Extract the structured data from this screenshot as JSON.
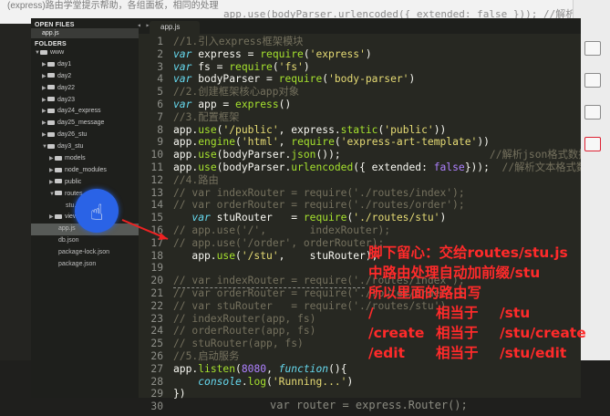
{
  "background": {
    "top_ghost_title": "(express)路由学堂提示帮助，各组面板，相同的处理",
    "top_ghost_code": "app.use(bodyParser.urlencoded({ extended: false })); //解析文本格式",
    "bottom_ghost_code": "var router = express.Router();"
  },
  "sidebar": {
    "open_files_header": "OPEN FILES",
    "open_file": "app.js",
    "folders_header": "FOLDERS",
    "tree": [
      {
        "label": "www",
        "level": 0,
        "type": "folder",
        "open": true
      },
      {
        "label": "day1",
        "level": 1,
        "type": "folder"
      },
      {
        "label": "day2",
        "level": 1,
        "type": "folder"
      },
      {
        "label": "day22",
        "level": 1,
        "type": "folder"
      },
      {
        "label": "day23",
        "level": 1,
        "type": "folder"
      },
      {
        "label": "day24_express",
        "level": 1,
        "type": "folder"
      },
      {
        "label": "day25_message",
        "level": 1,
        "type": "folder"
      },
      {
        "label": "day26_stu",
        "level": 1,
        "type": "folder"
      },
      {
        "label": "day3_stu",
        "level": 1,
        "type": "folder",
        "open": true
      },
      {
        "label": "models",
        "level": 2,
        "type": "folder"
      },
      {
        "label": "node_modules",
        "level": 2,
        "type": "folder"
      },
      {
        "label": "public",
        "level": 2,
        "type": "folder"
      },
      {
        "label": "routes",
        "level": 2,
        "type": "folder",
        "open": true
      },
      {
        "label": "stu.js",
        "level": 3,
        "type": "file"
      },
      {
        "label": "views",
        "level": 2,
        "type": "folder"
      },
      {
        "label": "app.js",
        "level": 2,
        "type": "file",
        "selected": true
      },
      {
        "label": "db.json",
        "level": 2,
        "type": "file"
      },
      {
        "label": "package-lock.json",
        "level": 2,
        "type": "file"
      },
      {
        "label": "package.json",
        "level": 2,
        "type": "file"
      }
    ]
  },
  "editor": {
    "tab_label": "app.js",
    "tab_nav": "◂ ▸",
    "line_numbers": [
      "1",
      "2",
      "3",
      "4",
      "5",
      "6",
      "7",
      "8",
      "9",
      "10",
      "11",
      "12",
      "13",
      "14",
      "15",
      "16",
      "17",
      "18",
      "19",
      "20",
      "21",
      "22",
      "23",
      "24",
      "25",
      "26",
      "27",
      "28",
      "29",
      "30"
    ],
    "code_lines": [
      [
        [
          "cm",
          "//1.引入express框架模块"
        ]
      ],
      [
        [
          "kw",
          "var"
        ],
        [
          "",
          "express = "
        ],
        [
          "fn",
          "require"
        ],
        [
          "",
          "("
        ],
        [
          "str",
          "'express'"
        ],
        [
          "",
          ")"
        ]
      ],
      [
        [
          "kw",
          "var"
        ],
        [
          "",
          "fs = "
        ],
        [
          "fn",
          "require"
        ],
        [
          "",
          "("
        ],
        [
          "str",
          "'fs'"
        ],
        [
          "",
          ")"
        ]
      ],
      [
        [
          "kw",
          "var"
        ],
        [
          "",
          "bodyParser = "
        ],
        [
          "fn",
          "require"
        ],
        [
          "",
          "("
        ],
        [
          "str",
          "'body-parser'"
        ],
        [
          "",
          ")"
        ]
      ],
      [
        [
          "cm",
          "//2.创建框架核心app对象"
        ]
      ],
      [
        [
          "kw",
          "var"
        ],
        [
          "",
          "app = "
        ],
        [
          "fn",
          "express"
        ],
        [
          "",
          "()"
        ]
      ],
      [
        [
          "cm",
          "//3.配置框架"
        ]
      ],
      [
        [
          "",
          "app."
        ],
        [
          "fn",
          "use"
        ],
        [
          "",
          "("
        ],
        [
          "str",
          "'/public'"
        ],
        [
          "",
          ", express."
        ],
        [
          "fn",
          "static"
        ],
        [
          "",
          "("
        ],
        [
          "str",
          "'public'"
        ],
        [
          "",
          "))"
        ]
      ],
      [
        [
          "",
          "app."
        ],
        [
          "fn",
          "engine"
        ],
        [
          "",
          "("
        ],
        [
          "str",
          "'html'"
        ],
        [
          "",
          ", "
        ],
        [
          "fn",
          "require"
        ],
        [
          "",
          "("
        ],
        [
          "str",
          "'express-art-template'"
        ],
        [
          "",
          "))"
        ]
      ],
      [
        [
          "",
          "app."
        ],
        [
          "fn",
          "use"
        ],
        [
          "",
          "(bodyParser."
        ],
        [
          "fn",
          "json"
        ],
        [
          "",
          "());                        "
        ],
        [
          "cm",
          "//解析json格式数据"
        ]
      ],
      [
        [
          "",
          "app."
        ],
        [
          "fn",
          "use"
        ],
        [
          "",
          "(bodyParser."
        ],
        [
          "fn",
          "urlencoded"
        ],
        [
          "",
          "({ extended: "
        ],
        [
          "num",
          "false"
        ],
        [
          "",
          ""
        ],
        [
          "",
          "}));  "
        ],
        [
          "cm",
          "//解析文本格式数据"
        ]
      ],
      [
        [
          "cm",
          "//4.路由"
        ]
      ],
      [
        [
          "cm",
          "// var indexRouter = require('./routes/index');"
        ]
      ],
      [
        [
          "cm",
          "// var orderRouter = require('./routes/order');"
        ]
      ],
      [
        [
          "",
          "   "
        ],
        [
          "kw",
          "var"
        ],
        [
          "",
          "stuRouter   = "
        ],
        [
          "fn",
          "require"
        ],
        [
          "",
          "("
        ],
        [
          "str",
          "'./routes/stu'"
        ],
        [
          "",
          ")"
        ]
      ],
      [
        [
          "cm",
          "// app.use('/',       indexRouter);"
        ]
      ],
      [
        [
          "cm",
          "// app.use('/order', orderRouter);"
        ]
      ],
      [
        [
          "",
          "   app."
        ],
        [
          "fn",
          "use"
        ],
        [
          "",
          "("
        ],
        [
          "str",
          "'/stu'"
        ],
        [
          "",
          ",    stuRouter);"
        ]
      ],
      [
        [
          "cm",
          ""
        ]
      ],
      [
        [
          "cm",
          "// var indexRouter = require('./routes/index');"
        ]
      ],
      [
        [
          "cm",
          "// var orderRouter = require('./routes/order');"
        ]
      ],
      [
        [
          "cm",
          "// var stuRouter   = require('./routes/stu')"
        ]
      ],
      [
        [
          "cm",
          "// indexRouter(app, fs)"
        ]
      ],
      [
        [
          "cm",
          "// orderRouter(app, fs)"
        ]
      ],
      [
        [
          "cm",
          "// stuRouter(app, fs)"
        ]
      ],
      [
        [
          "cm",
          "//5.启动服务"
        ]
      ],
      [
        [
          "",
          "app."
        ],
        [
          "fn",
          "listen"
        ],
        [
          "",
          "("
        ],
        [
          "num",
          "8080"
        ],
        [
          "",
          ", "
        ],
        [
          "ital",
          "function"
        ],
        [
          "",
          "(){"
        ]
      ],
      [
        [
          "",
          "    "
        ],
        [
          "ital",
          "console"
        ],
        [
          "",
          "."
        ],
        [
          "fn",
          "log"
        ],
        [
          "",
          "("
        ],
        [
          "str",
          "'Running...'"
        ],
        [
          "",
          ")"
        ]
      ],
      [
        [
          "",
          "})"
        ]
      ],
      [
        [
          "",
          ""
        ]
      ]
    ]
  },
  "annotation": {
    "line1": "脚下留心：交给routes/stu.js",
    "line2": "中路由处理自动加前缀/stu",
    "line3": "所以里面的路由写",
    "rows": [
      {
        "route": "/",
        "eq": "相当于",
        "target": "/stu"
      },
      {
        "route": "/create",
        "eq": "相当于",
        "target": "/stu/create"
      },
      {
        "route": "/edit",
        "eq": "相当于",
        "target": "/stu/edit"
      }
    ],
    "color": "#ff2a2a"
  },
  "colors": {
    "editor_bg": "#272822",
    "sidebar_bg": "#1e1f1c",
    "cursor_highlight": "#2a63e6"
  }
}
